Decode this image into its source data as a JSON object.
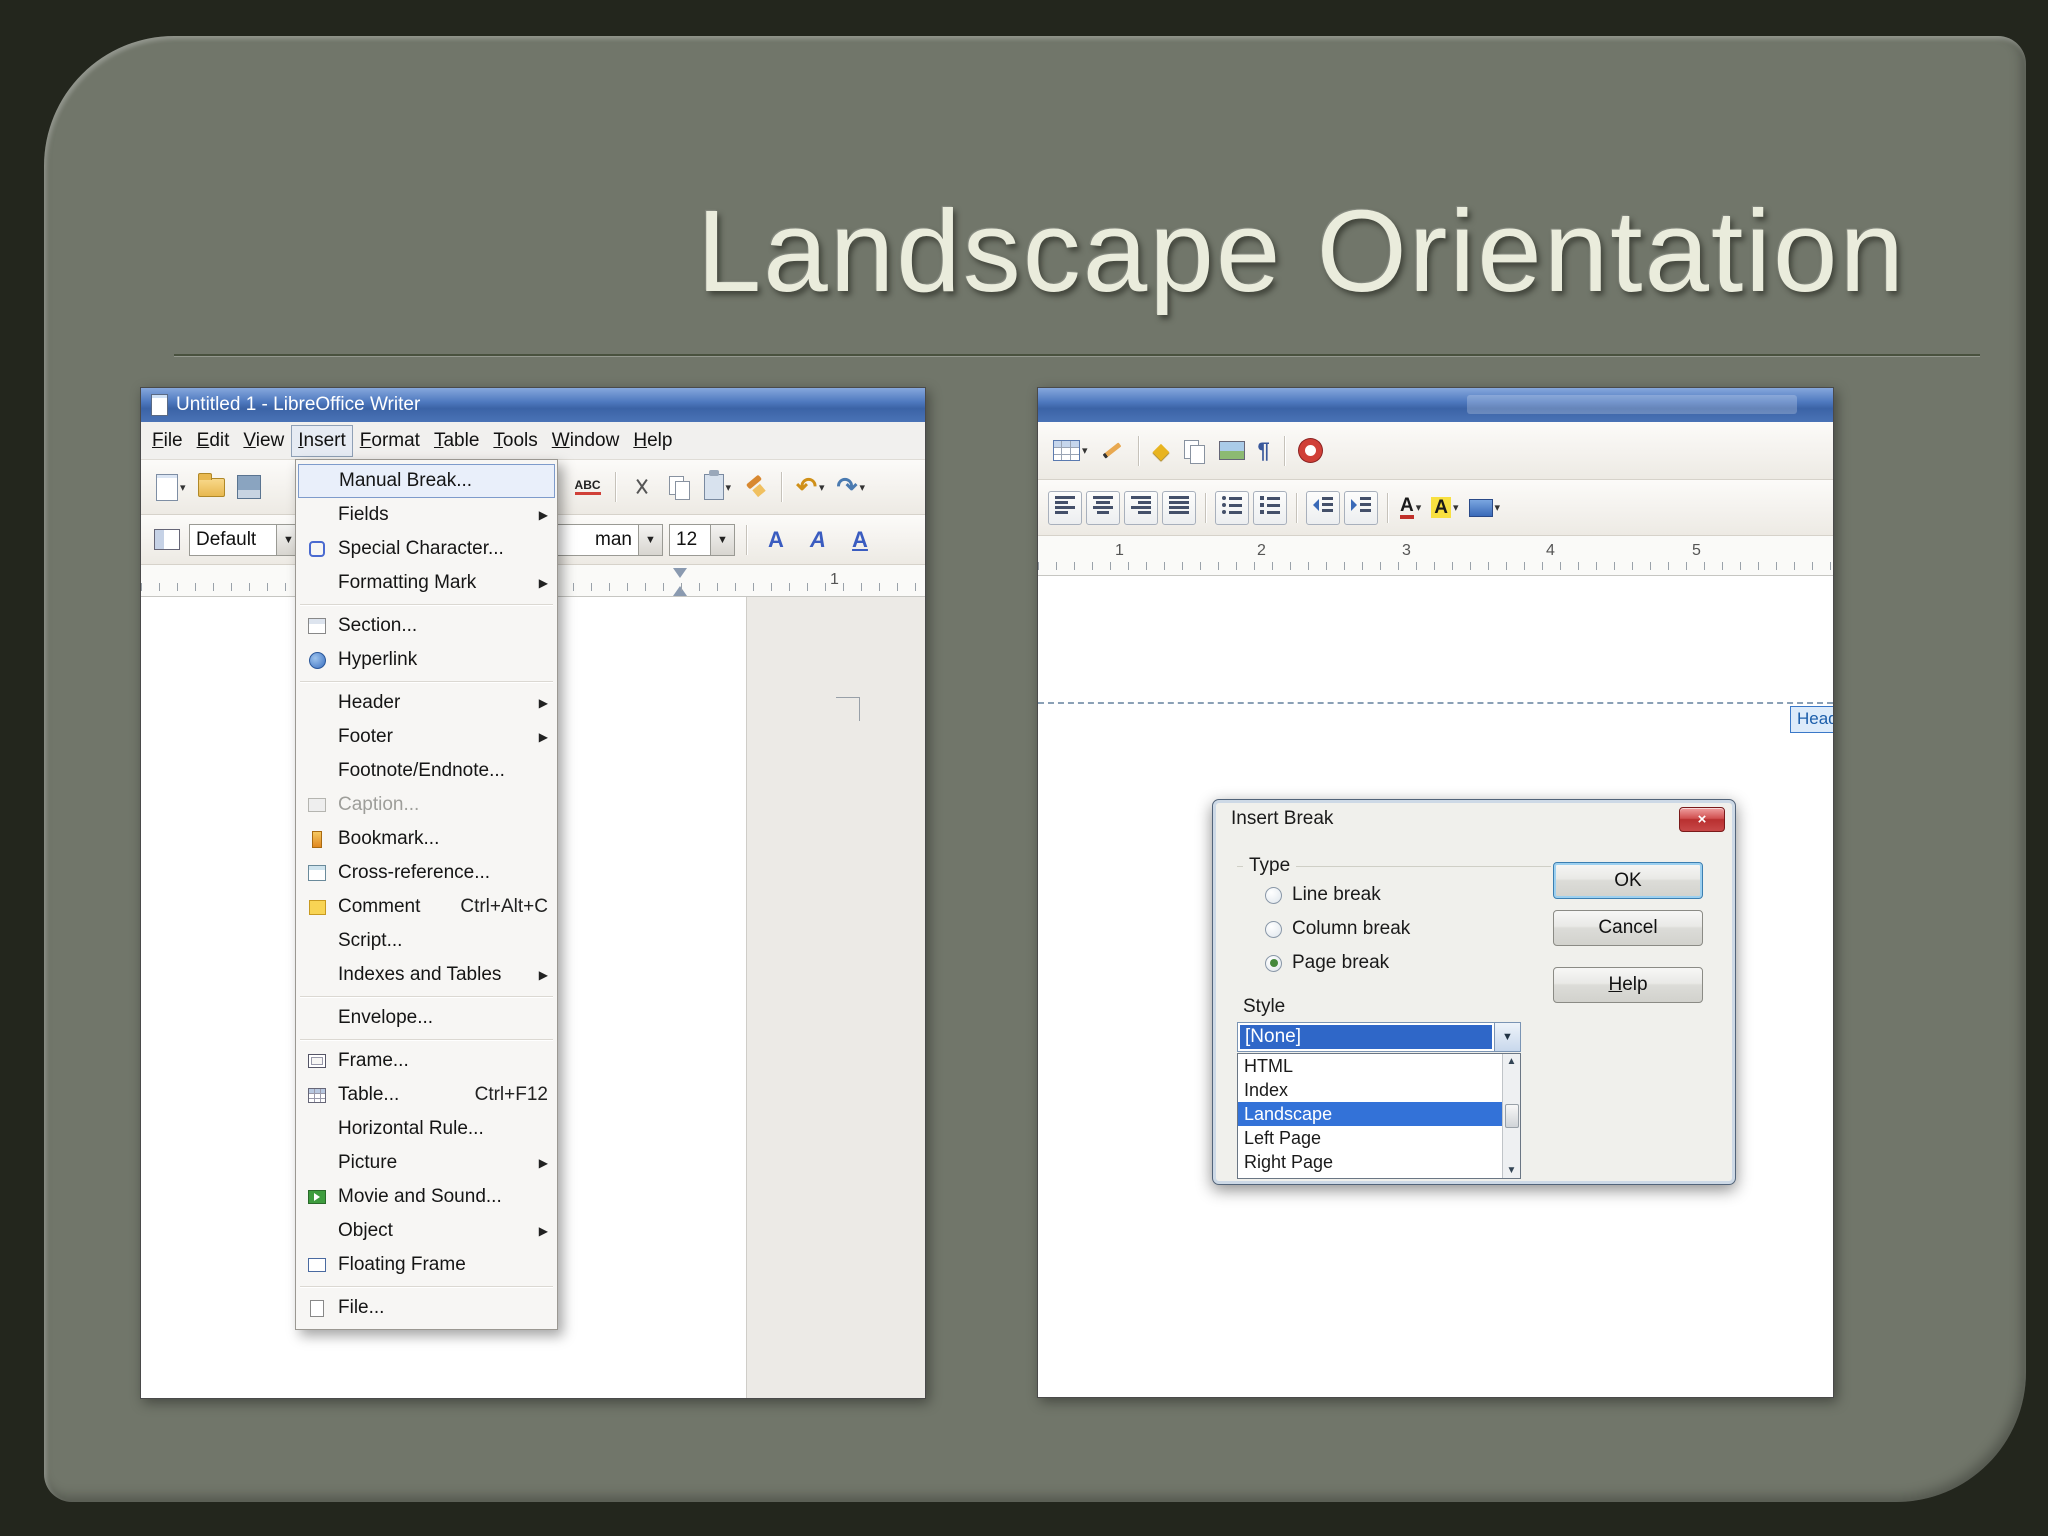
{
  "slide": {
    "title": "Landscape Orientation"
  },
  "icons": {
    "caret": "▼",
    "caret_small": "▾",
    "submenu_arrow": "▶",
    "close": "×",
    "undo": "↶",
    "redo": "↷",
    "pilcrow": "¶",
    "diamond": "◆",
    "scroll_up": "▲",
    "scroll_down": "▼",
    "letter_a": "A",
    "abc": "ABC"
  },
  "left_window": {
    "title": "Untitled 1 - LibreOffice Writer",
    "menubar": [
      "File",
      "Edit",
      "View",
      "Insert",
      "Format",
      "Table",
      "Tools",
      "Window",
      "Help"
    ],
    "active_menu": "Insert",
    "toolbar2": {
      "style_value": "Default",
      "font_visible": "man",
      "size_value": "12"
    },
    "ruler_numbers": [
      "1"
    ],
    "insert_menu": {
      "items": [
        {
          "label": "Manual Break..."
        },
        {
          "label": "Fields"
        },
        {
          "label": "Special Character..."
        },
        {
          "label": "Formatting Mark"
        },
        {
          "label": "Section..."
        },
        {
          "label": "Hyperlink"
        },
        {
          "label": "Header"
        },
        {
          "label": "Footer"
        },
        {
          "label": "Footnote/Endnote..."
        },
        {
          "label": "Caption..."
        },
        {
          "label": "Bookmark..."
        },
        {
          "label": "Cross-reference..."
        },
        {
          "label": "Comment",
          "shortcut": "Ctrl+Alt+C"
        },
        {
          "label": "Script..."
        },
        {
          "label": "Indexes and Tables"
        },
        {
          "label": "Envelope..."
        },
        {
          "label": "Frame..."
        },
        {
          "label": "Table...",
          "shortcut": "Ctrl+F12"
        },
        {
          "label": "Horizontal Rule..."
        },
        {
          "label": "Picture"
        },
        {
          "label": "Movie and Sound..."
        },
        {
          "label": "Object"
        },
        {
          "label": "Floating Frame"
        },
        {
          "label": "File..."
        }
      ]
    }
  },
  "right_window": {
    "ruler_numbers": [
      "1",
      "2",
      "3",
      "4",
      "5"
    ],
    "header_tag": "Head",
    "dialog": {
      "title": "Insert Break",
      "type_group_label": "Type",
      "radio_options": [
        {
          "label": "Line break"
        },
        {
          "label": "Column break"
        },
        {
          "label": "Page break"
        }
      ],
      "selected_radio": "Page break",
      "style_label": "Style",
      "style_value": "[None]",
      "style_options": [
        "HTML",
        "Index",
        "Landscape",
        "Left Page",
        "Right Page"
      ],
      "selected_style_option": "Landscape",
      "ok_label": "OK",
      "cancel_label": "Cancel",
      "help_label": "Help"
    }
  }
}
